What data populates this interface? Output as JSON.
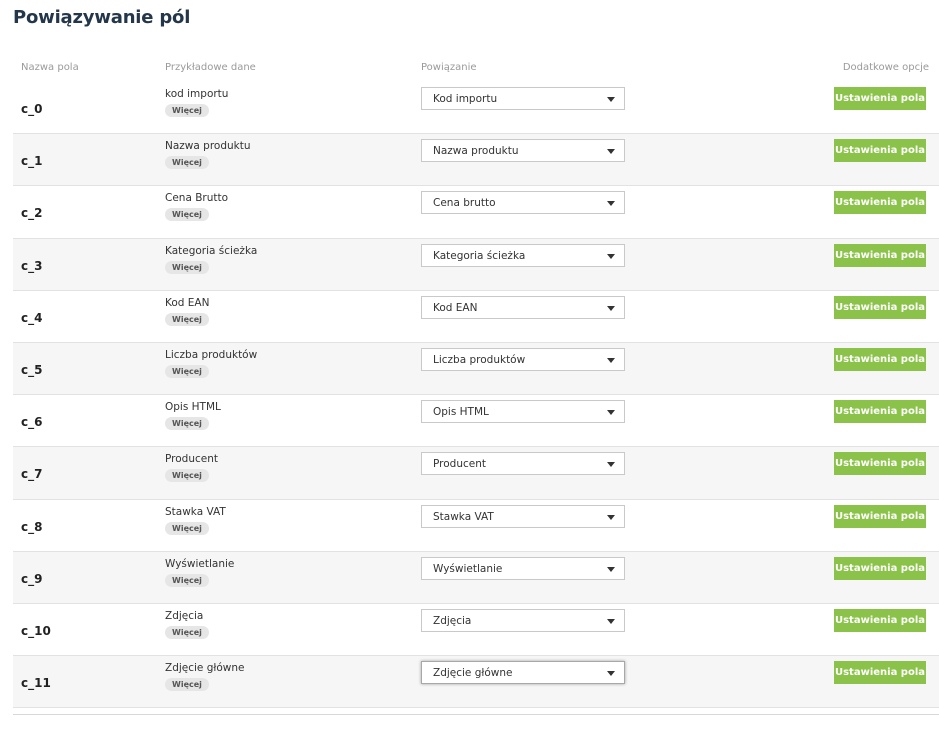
{
  "page": {
    "title": "Powiązywanie pól"
  },
  "columns": {
    "name": "Nazwa pola",
    "sample": "Przykładowe dane",
    "binding": "Powiązanie",
    "extra": "Dodatkowe opcje"
  },
  "more_label": "Więcej",
  "settings_label": "Ustawienia pola",
  "colors": {
    "accent": "#8bc34a",
    "title": "#23364a"
  },
  "rows": [
    {
      "name": "c_0",
      "sample": "kod importu",
      "binding": "Kod importu"
    },
    {
      "name": "c_1",
      "sample": "Nazwa produktu",
      "binding": "Nazwa produktu"
    },
    {
      "name": "c_2",
      "sample": "Cena Brutto",
      "binding": "Cena brutto"
    },
    {
      "name": "c_3",
      "sample": "Kategoria ścieżka",
      "binding": "Kategoria ścieżka"
    },
    {
      "name": "c_4",
      "sample": "Kod EAN",
      "binding": "Kod EAN"
    },
    {
      "name": "c_5",
      "sample": "Liczba produktów",
      "binding": "Liczba produktów"
    },
    {
      "name": "c_6",
      "sample": "Opis HTML",
      "binding": "Opis HTML"
    },
    {
      "name": "c_7",
      "sample": "Producent",
      "binding": "Producent"
    },
    {
      "name": "c_8",
      "sample": "Stawka VAT",
      "binding": "Stawka VAT"
    },
    {
      "name": "c_9",
      "sample": "Wyświetlanie",
      "binding": "Wyświetlanie"
    },
    {
      "name": "c_10",
      "sample": "Zdjęcia",
      "binding": "Zdjęcia"
    },
    {
      "name": "c_11",
      "sample": "Zdjęcie główne",
      "binding": "Zdjęcie główne"
    }
  ]
}
